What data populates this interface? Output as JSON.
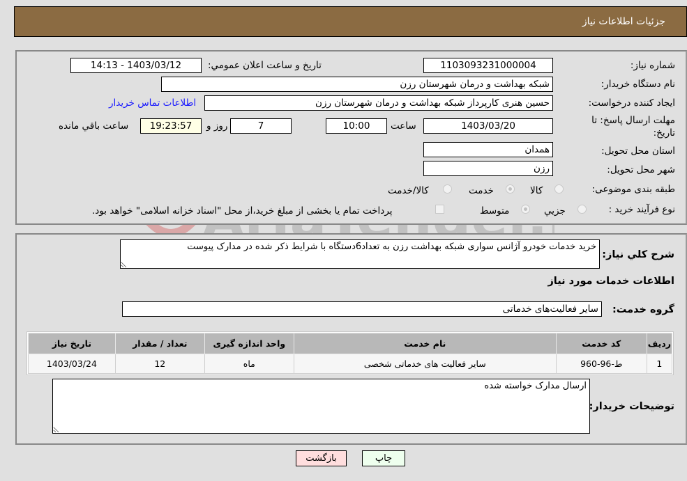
{
  "header": {
    "title": "جزئیات اطلاعات نیاز"
  },
  "form": {
    "need_number": {
      "label": "شماره نیاز:",
      "value": "1103093231000004"
    },
    "announce_datetime": {
      "label": "تاریخ و ساعت اعلان عمومي:",
      "value": "1403/03/12 - 14:13"
    },
    "buyer_org": {
      "label": "نام دستگاه خریدار:",
      "value": "شبکه بهداشت و درمان شهرستان رزن"
    },
    "requester": {
      "label": "ایجاد کننده درخواست:",
      "value": "حسین هنری کارپرداز شبکه بهداشت و درمان شهرستان رزن"
    },
    "buyer_contact_link": "اطلاعات تماس خریدار",
    "deadline": {
      "label_line1": "مهلت ارسال پاسخ: تا",
      "label_line2": "تاریخ:",
      "date": "1403/03/20",
      "time_label": "ساعت",
      "time": "10:00",
      "days": "7",
      "days_label": "روز و",
      "remaining": "19:23:57",
      "remaining_label": "ساعت باقي مانده"
    },
    "province": {
      "label": "استان محل تحویل:",
      "value": "همدان"
    },
    "city": {
      "label": "شهر محل تحویل:",
      "value": "رزن"
    },
    "category": {
      "label": "طبقه بندی موضوعی:",
      "options": [
        {
          "label": "کالا",
          "checked": false
        },
        {
          "label": "خدمت",
          "checked": true
        },
        {
          "label": "کالا/خدمت",
          "checked": false
        }
      ]
    },
    "purchase_type": {
      "label": "نوع فرآیند خرید :",
      "options": [
        {
          "label": "جزيي",
          "checked": false
        },
        {
          "label": "متوسط",
          "checked": true
        }
      ],
      "treasury_checkbox_label": "پرداخت تمام یا بخشی از مبلغ خرید،از محل \"اسناد خزانه اسلامی\" خواهد بود.",
      "treasury_checked": false
    }
  },
  "details": {
    "description_label": "شرح کلي نیاز:",
    "description": "خرید خدمات خودرو آژانس سواری شبکه بهداشت رزن به تعداد6دستگاه با شرایط ذکر شده در مدارک پیوست",
    "services_heading": "اطلاعات خدمات مورد نیاز",
    "service_group_label": "گروه خدمت:",
    "service_group": "سایر فعالیت‌های خدماتی",
    "table": {
      "columns": [
        "ردیف",
        "کد خدمت",
        "نام خدمت",
        "واحد اندازه گیری",
        "تعداد / مقدار",
        "تاریخ نیاز"
      ],
      "rows": [
        [
          "1",
          "ط-96-960",
          "سایر فعالیت های خدماتی شخصی",
          "ماه",
          "12",
          "1403/03/24"
        ]
      ]
    },
    "buyer_notes_label": "توضیحات خریدار:",
    "buyer_notes": "ارسال مدارک خواسته شده"
  },
  "buttons": {
    "print": "چاپ",
    "back": "بازگشت"
  },
  "watermark": {
    "text": "AriaTender.neT"
  }
}
